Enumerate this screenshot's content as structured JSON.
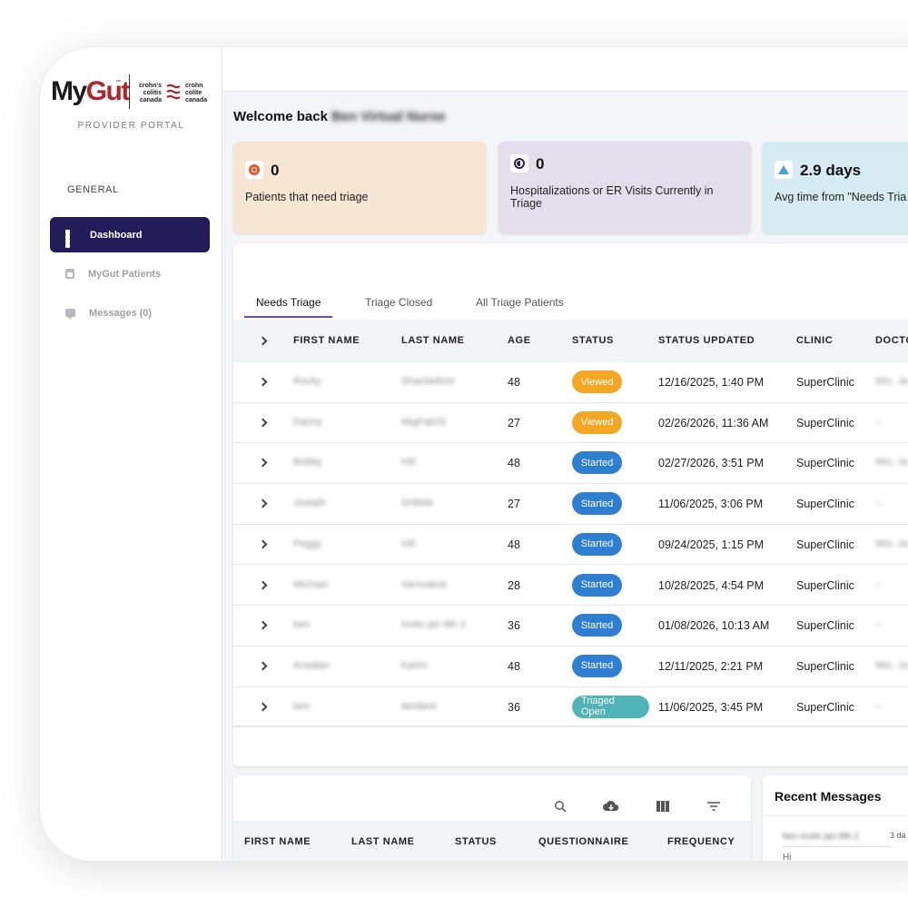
{
  "brand": {
    "logo_my": "My",
    "logo_gut": "Gut",
    "logo_tm": "™",
    "ccc_en": "crohn's colitis canada",
    "ccc_fr": "crohn colite canada",
    "subtitle": "PROVIDER PORTAL"
  },
  "sidebar": {
    "section": "GENERAL",
    "items": [
      {
        "label": "Dashboard",
        "icon": "dashboard-grid-icon",
        "active": true
      },
      {
        "label": "MyGut Patients",
        "icon": "calendar-icon",
        "active": false
      },
      {
        "label": "Messages (0)",
        "icon": "message-icon",
        "active": false
      }
    ]
  },
  "header": {
    "welcome": "Welcome back",
    "user_name": "Ben Virtual Nurse"
  },
  "stats": [
    {
      "value": "0",
      "label": "Patients that need triage",
      "icon": "target-icon",
      "color": "#f7e6d2"
    },
    {
      "value": "0",
      "label": "Hospitalizations or ER Visits Currently in Triage",
      "icon": "moon-icon",
      "color": "#e4ddec"
    },
    {
      "value": "2.9 days",
      "label": "Avg time from \"Needs Tria",
      "icon": "triangle-icon",
      "color": "#d6ecf3"
    }
  ],
  "triage": {
    "tabs": [
      "Needs Triage",
      "Triage Closed",
      "All Triage Patients"
    ],
    "active_tab": 0,
    "columns": [
      "FIRST NAME",
      "LAST NAME",
      "AGE",
      "STATUS",
      "STATUS UPDATED",
      "CLINIC",
      "DOCTO"
    ],
    "rows": [
      {
        "first": "Rocky",
        "last": "Shackleford",
        "age": "48",
        "status": "Viewed",
        "updated": "12/16/2025, 1:40 PM",
        "clinic": "SuperClinic",
        "doctor": "Wiz, Ja"
      },
      {
        "first": "Danny",
        "last": "MigFab25",
        "age": "27",
        "status": "Viewed",
        "updated": "02/26/2026, 11:36 AM",
        "clinic": "SuperClinic",
        "doctor": "--"
      },
      {
        "first": "Bobby",
        "last": "Hill",
        "age": "48",
        "status": "Started",
        "updated": "02/27/2026, 3:51 PM",
        "clinic": "SuperClinic",
        "doctor": "Wiz, Ja"
      },
      {
        "first": "Joseph",
        "last": "Gribble",
        "age": "27",
        "status": "Started",
        "updated": "11/06/2025, 3:06 PM",
        "clinic": "SuperClinic",
        "doctor": "--"
      },
      {
        "first": "Peggy",
        "last": "Hill",
        "age": "48",
        "status": "Started",
        "updated": "09/24/2025, 1:15 PM",
        "clinic": "SuperClinic",
        "doctor": "Wiz, Ja"
      },
      {
        "first": "Michael",
        "last": "Vamvakas",
        "age": "28",
        "status": "Started",
        "updated": "10/28/2025, 4:54 PM",
        "clinic": "SuperClinic",
        "doctor": "--"
      },
      {
        "first": "ben",
        "last": "invite jan 8th 2",
        "age": "36",
        "status": "Started",
        "updated": "01/08/2026, 10:13 AM",
        "clinic": "SuperClinic",
        "doctor": "--"
      },
      {
        "first": "Ansalan",
        "last": "Karim",
        "age": "48",
        "status": "Started",
        "updated": "12/11/2025, 2:21 PM",
        "clinic": "SuperClinic",
        "doctor": "Wiz, Ja"
      },
      {
        "first": "ben",
        "last": "ttesttest",
        "age": "36",
        "status": "Triaged Open",
        "updated": "11/06/2025, 3:45 PM",
        "clinic": "SuperClinic",
        "doctor": "--"
      }
    ],
    "status_colors": {
      "Viewed": "#f5a623",
      "Started": "#2e7fd1",
      "Triaged Open": "#4fb3b8"
    }
  },
  "questionnaires": {
    "tools": [
      "search-icon",
      "cloud-download-icon",
      "columns-icon",
      "filter-icon"
    ],
    "columns": [
      "FIRST NAME",
      "LAST NAME",
      "STATUS",
      "QUESTIONNAIRE",
      "FREQUENCY"
    ]
  },
  "recent_messages": {
    "title": "Recent Messages",
    "sender": "ben invite jan 8th 2",
    "time": "3 da",
    "preview": "Hi"
  }
}
